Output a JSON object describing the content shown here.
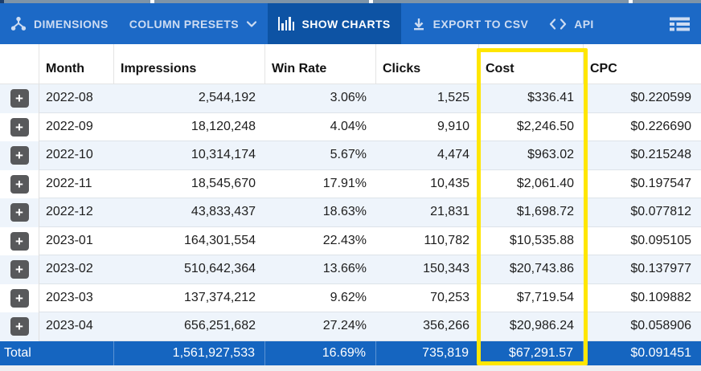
{
  "toolbar": {
    "dimensions_label": "DIMENSIONS",
    "column_presets_label": "COLUMN PRESETS",
    "show_charts_label": "SHOW CHARTS",
    "export_csv_label": "EXPORT TO CSV",
    "api_label": "API",
    "icons": [
      "share-nodes-icon",
      "chevron-down-icon",
      "bar-chart-icon",
      "download-icon",
      "code-brackets-icon",
      "list-menu-icon"
    ]
  },
  "colors": {
    "toolbar_bg": "#1c69c6",
    "toolbar_active_bg": "#0d53a4",
    "total_row_bg": "#1565c0",
    "highlight_border": "#ffe600",
    "alt_row_bg": "#eef4fb",
    "expand_button_bg": "#58595b"
  },
  "table": {
    "columns": [
      "Month",
      "Impressions",
      "Win Rate",
      "Clicks",
      "Cost",
      "CPC"
    ],
    "highlighted_column": "Cost",
    "expand_button_label": "+",
    "rows": [
      {
        "month": "2022-08",
        "impressions": "2,544,192",
        "win_rate": "3.06%",
        "clicks": "1,525",
        "cost": "$336.41",
        "cpc": "$0.220599"
      },
      {
        "month": "2022-09",
        "impressions": "18,120,248",
        "win_rate": "4.04%",
        "clicks": "9,910",
        "cost": "$2,246.50",
        "cpc": "$0.226690"
      },
      {
        "month": "2022-10",
        "impressions": "10,314,174",
        "win_rate": "5.67%",
        "clicks": "4,474",
        "cost": "$963.02",
        "cpc": "$0.215248"
      },
      {
        "month": "2022-11",
        "impressions": "18,545,670",
        "win_rate": "17.91%",
        "clicks": "10,435",
        "cost": "$2,061.40",
        "cpc": "$0.197547"
      },
      {
        "month": "2022-12",
        "impressions": "43,833,437",
        "win_rate": "18.63%",
        "clicks": "21,831",
        "cost": "$1,698.72",
        "cpc": "$0.077812"
      },
      {
        "month": "2023-01",
        "impressions": "164,301,554",
        "win_rate": "22.43%",
        "clicks": "110,782",
        "cost": "$10,535.88",
        "cpc": "$0.095105"
      },
      {
        "month": "2023-02",
        "impressions": "510,642,364",
        "win_rate": "13.66%",
        "clicks": "150,343",
        "cost": "$20,743.86",
        "cpc": "$0.137977"
      },
      {
        "month": "2023-03",
        "impressions": "137,374,212",
        "win_rate": "9.62%",
        "clicks": "70,253",
        "cost": "$7,719.54",
        "cpc": "$0.109882"
      },
      {
        "month": "2023-04",
        "impressions": "656,251,682",
        "win_rate": "27.24%",
        "clicks": "356,266",
        "cost": "$20,986.24",
        "cpc": "$0.058906"
      }
    ],
    "total": {
      "label": "Total",
      "impressions": "1,561,927,533",
      "win_rate": "16.69%",
      "clicks": "735,819",
      "cost": "$67,291.57",
      "cpc": "$0.091451"
    }
  }
}
